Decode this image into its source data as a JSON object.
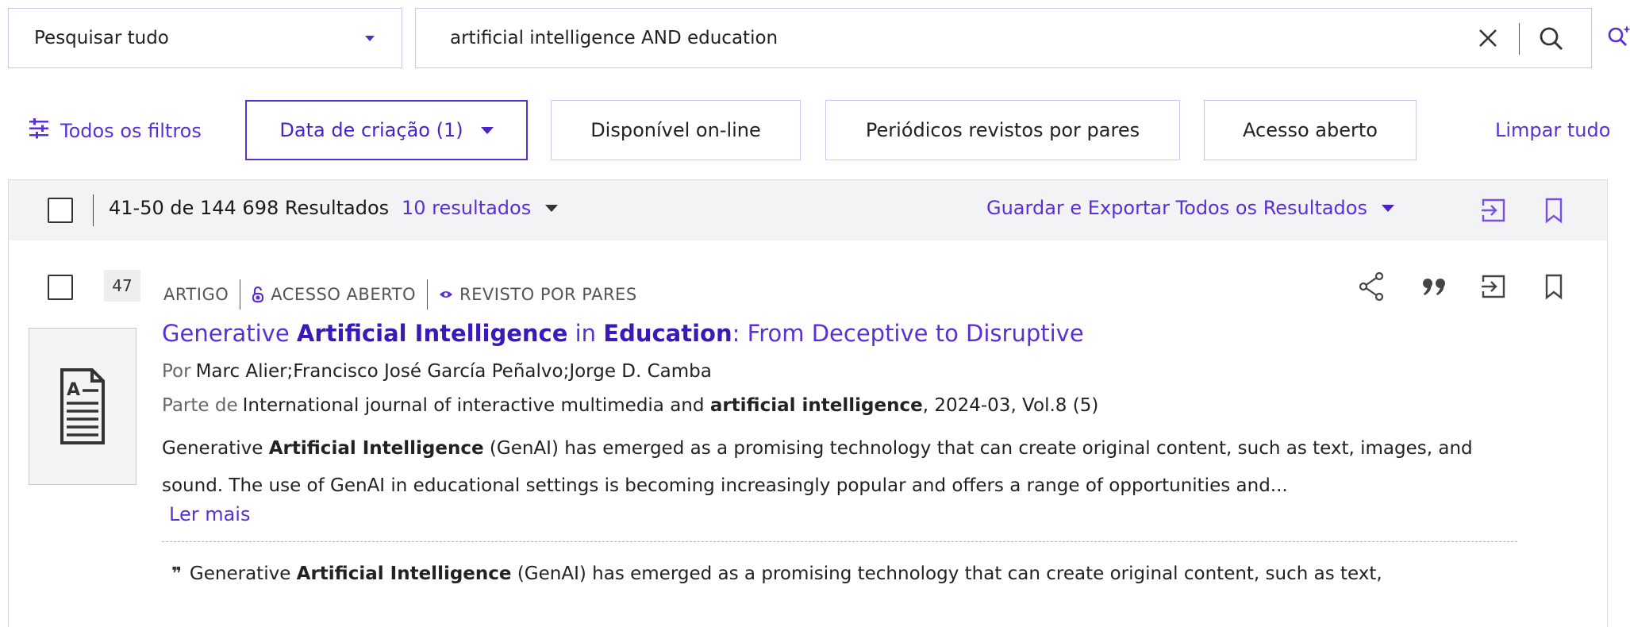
{
  "search": {
    "scope": "Pesquisar tudo",
    "query": "artificial intelligence AND education"
  },
  "filters": {
    "all_filters": "Todos os filtros",
    "buttons": [
      {
        "label": "Data de criação (1)"
      },
      {
        "label": "Disponível on-line"
      },
      {
        "label": "Periódicos revistos por pares"
      },
      {
        "label": "Acesso aberto"
      }
    ],
    "clear_all": "Limpar tudo"
  },
  "results": {
    "count": "41-50 de 144 698 Resultados",
    "page_size": "10 resultados",
    "save_export": "Guardar e Exportar Todos os Resultados"
  },
  "record": {
    "number": "47",
    "type": "ARTIGO",
    "open_access": "ACESSO ABERTO",
    "peer_reviewed": "REVISTO POR PARES",
    "title_parts": [
      "Generative ",
      "Artificial Intelligence",
      " in ",
      "Education",
      ": From Deceptive to Disruptive"
    ],
    "by_label": "Por",
    "authors": "Marc Alier;Francisco José García Peñalvo;Jorge D. Camba",
    "part_of_label": "Parte de",
    "source_prefix": "International journal of interactive multimedia and ",
    "source_bold": "artificial intelligence",
    "source_suffix": ", 2024-03, Vol.8 (5)",
    "abstract_pre": "Generative ",
    "abstract_bold": "Artificial Intelligence",
    "abstract_post": " (GenAI) has emerged as a promising technology that can create original content, such as text, images, and sound. The use of GenAI in educational settings is becoming increasingly popular and offers a range of opportunities and...",
    "read_more": "Ler mais",
    "snippet_quote": "❞",
    "snippet_pre": "Generative ",
    "snippet_bold": "Artificial Intelligence",
    "snippet_post": " (GenAI) has emerged as a promising technology that can create original content, such as text,"
  },
  "colors": {
    "accent": "#5a2fd6",
    "accent_dark": "#3a19b8",
    "header_bg": "#f3f3f5"
  }
}
